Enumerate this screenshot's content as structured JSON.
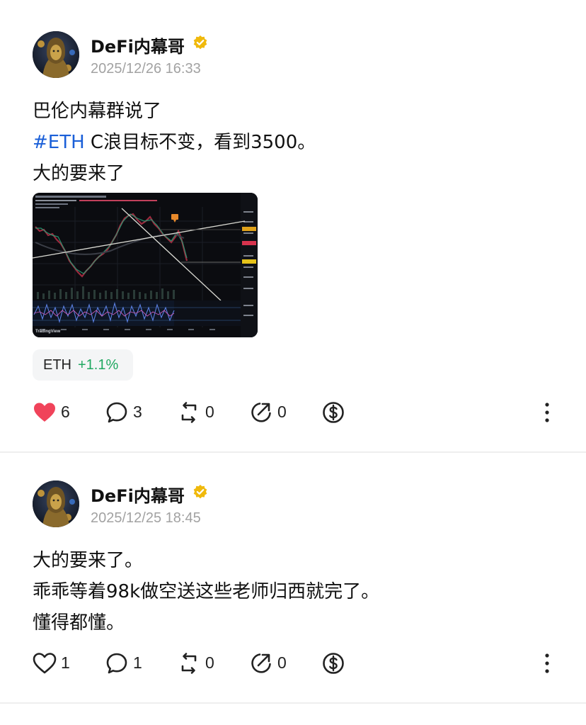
{
  "posts": [
    {
      "author": "DeFi内幕哥",
      "timestamp": "2025/12/26 16:33",
      "lines": {
        "l1": "巴伦内幕群说了",
        "l2_hashtag": "#ETH",
        "l2_rest": " C浪目标不变，看到3500。",
        "l3": "大的要来了"
      },
      "chart_watermark": "TradingView",
      "ticker": {
        "symbol": "ETH",
        "change": "+1.1%"
      },
      "actions": {
        "likes": "6",
        "comments": "3",
        "reposts": "0",
        "shares": "0"
      },
      "liked": true
    },
    {
      "author": "DeFi内幕哥",
      "timestamp": "2025/12/25 18:45",
      "lines": {
        "l1": "大的要来了。",
        "l2": "乖乖等着98k做空送这些老师归西就完了。",
        "l3": "懂得都懂。"
      },
      "actions": {
        "likes": "1",
        "comments": "1",
        "reposts": "0",
        "shares": "0"
      },
      "liked": false
    }
  ],
  "colors": {
    "accent_link": "#1a5fd8",
    "positive": "#1fa860",
    "like_active": "#f0435a",
    "verified": "#f0b90b",
    "muted": "#a2a2a2"
  },
  "icons": [
    "heart-icon",
    "comment-icon",
    "repost-icon",
    "share-icon",
    "tip-dollar-icon",
    "more-vertical-icon",
    "verified-badge-icon"
  ]
}
